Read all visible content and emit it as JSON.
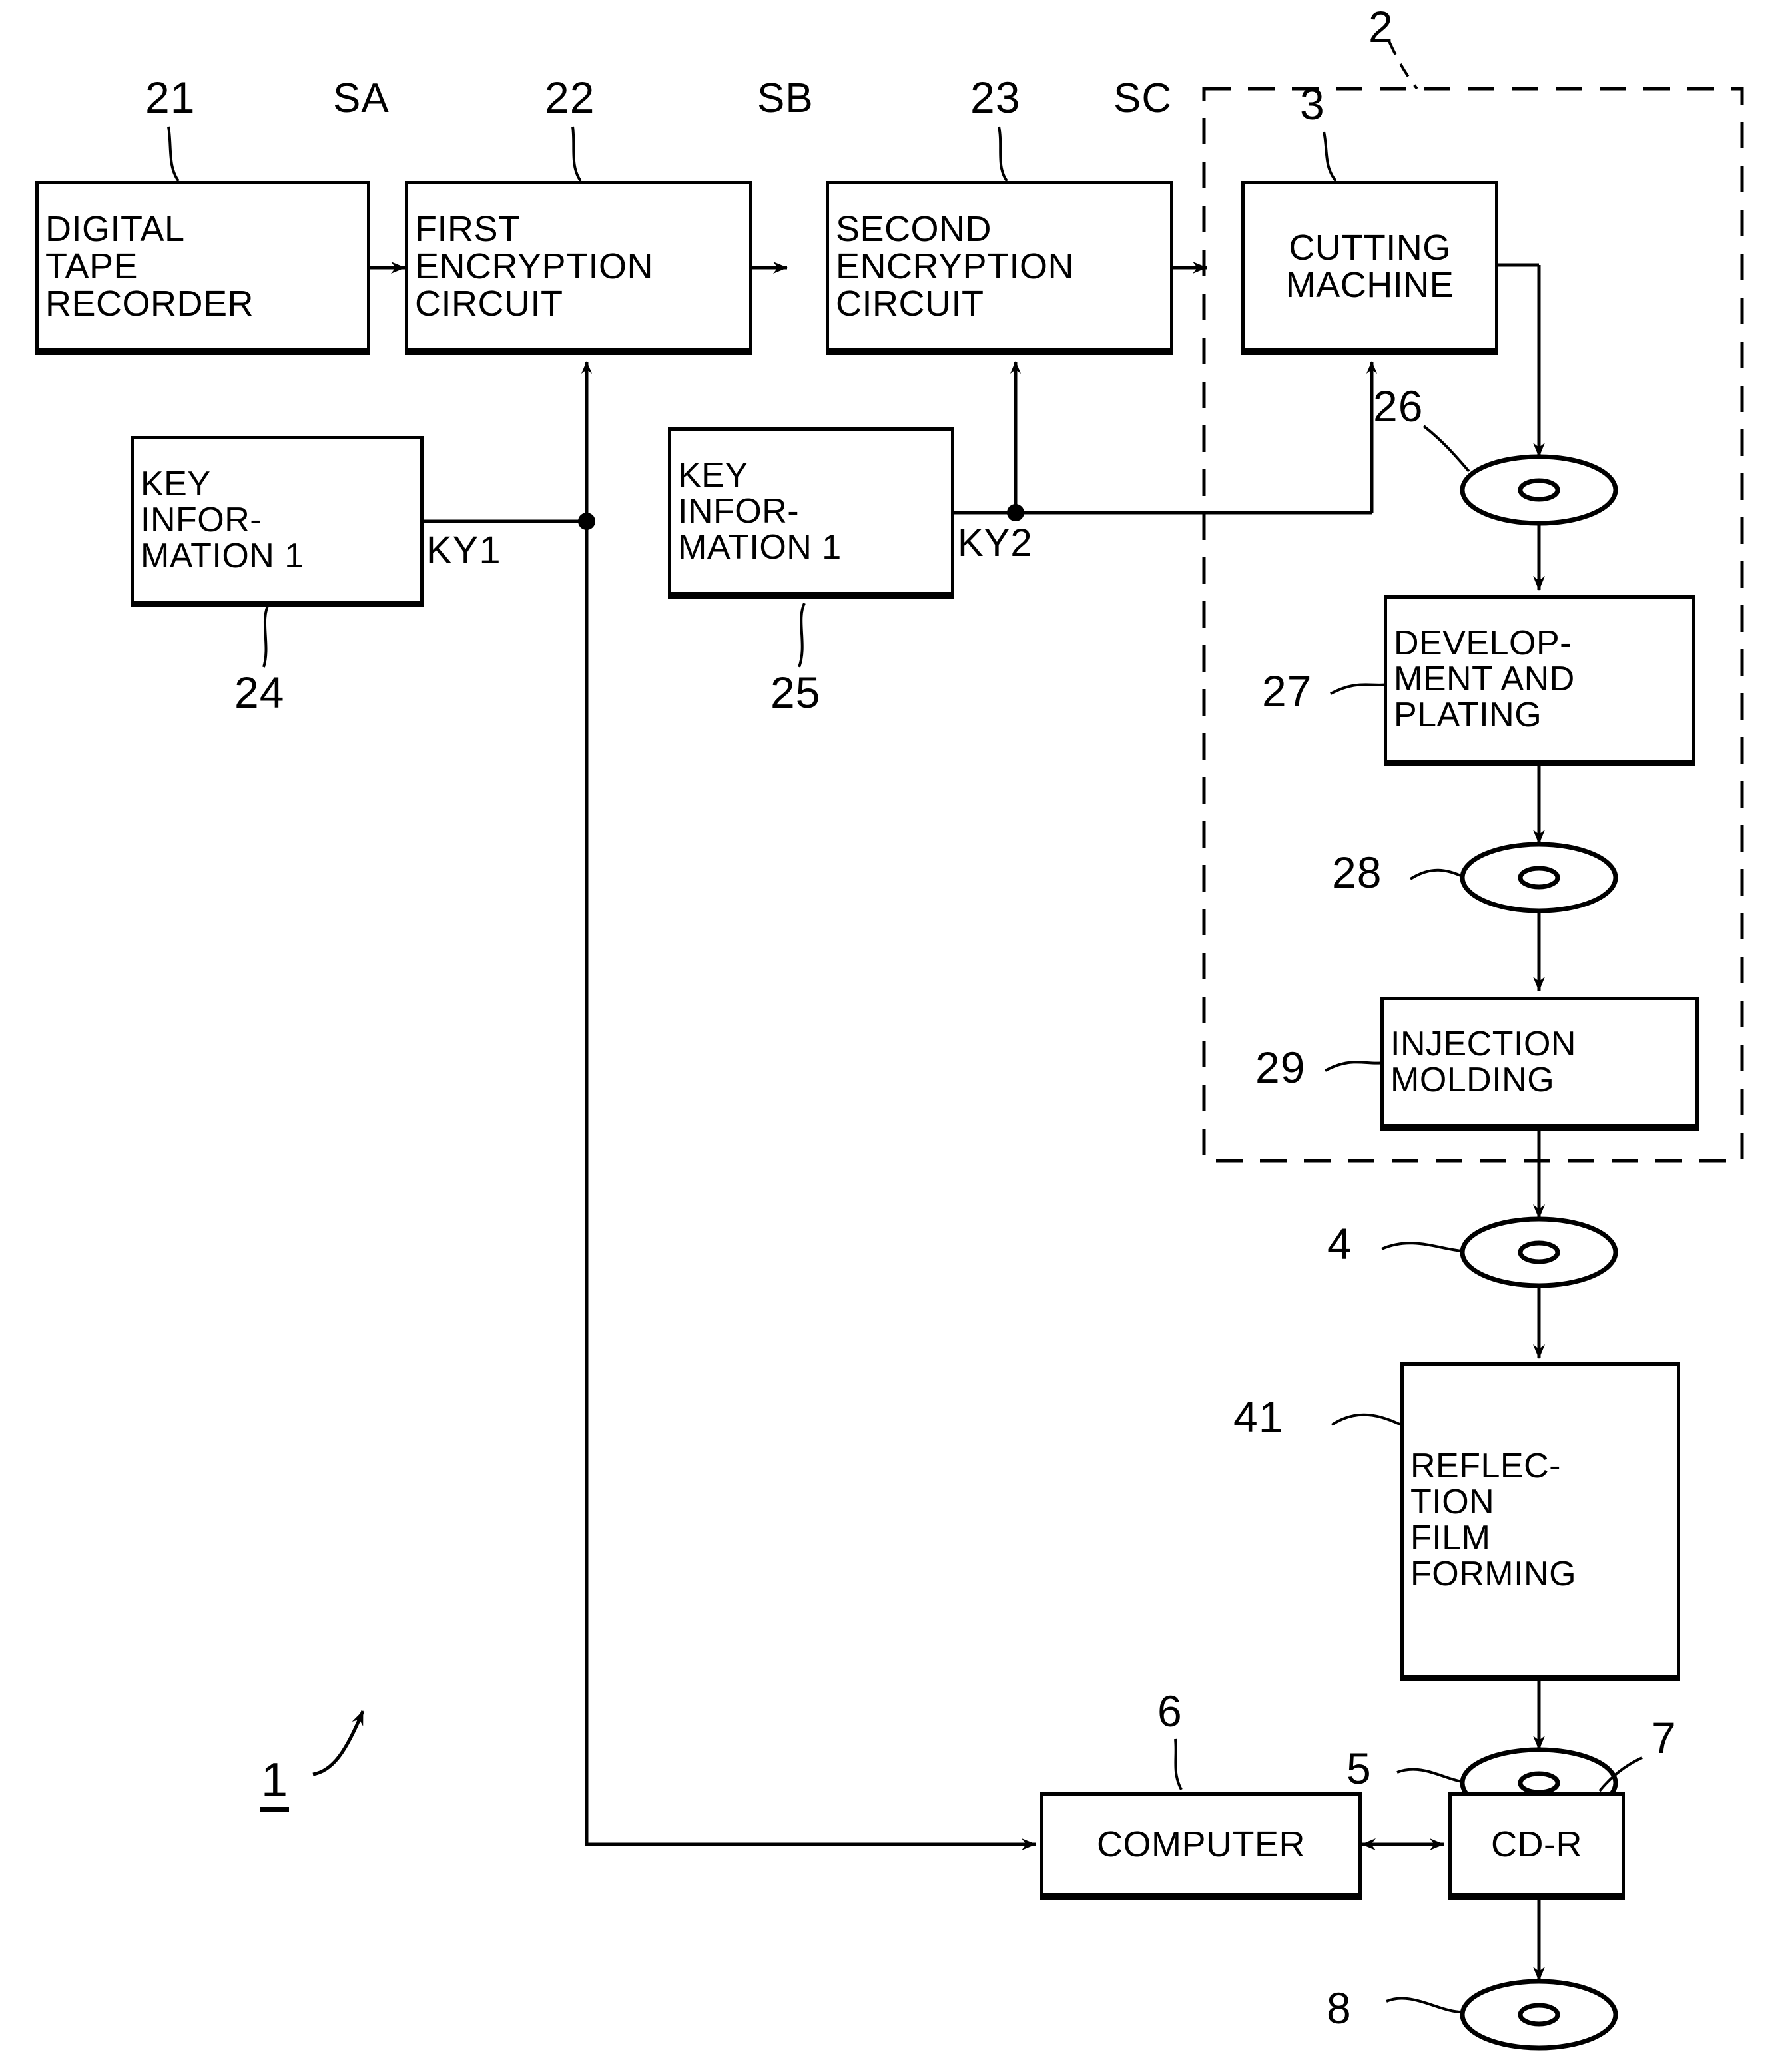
{
  "figure": {
    "figure_number": "1",
    "enclosure_label": "2"
  },
  "blocks": [
    {
      "id": "digital-tape-recorder",
      "ref": "21",
      "lines": [
        "DIGITAL",
        "TAPE",
        "RECORDER"
      ]
    },
    {
      "id": "first-encryption-circuit",
      "ref": "22",
      "lines": [
        "FIRST",
        "ENCRYPTION",
        "CIRCUIT"
      ]
    },
    {
      "id": "second-encryption-circuit",
      "ref": "23",
      "lines": [
        "SECOND",
        "ENCRYPTION",
        "CIRCUIT"
      ]
    },
    {
      "id": "cutting-machine",
      "ref": "3",
      "lines": [
        "CUTTING",
        "MACHINE"
      ]
    },
    {
      "id": "key-information-1",
      "ref": "24",
      "lines": [
        "KEY",
        "INFOR-",
        "MATION 1"
      ]
    },
    {
      "id": "key-information-2",
      "ref": "25",
      "lines": [
        "KEY",
        "INFOR-",
        "MATION 1"
      ]
    },
    {
      "id": "development-and-plating",
      "ref": "27",
      "lines": [
        "DEVELOP-",
        "MENT AND",
        "PLATING"
      ]
    },
    {
      "id": "injection-molding",
      "ref": "29",
      "lines": [
        "INJECTION",
        "MOLDING"
      ]
    },
    {
      "id": "reflection-film-forming",
      "ref": "41",
      "lines": [
        "REFLEC-",
        "TION",
        "FILM",
        "FORMING"
      ]
    },
    {
      "id": "computer",
      "ref": "6",
      "lines": [
        "COMPUTER"
      ]
    },
    {
      "id": "cd-r",
      "ref": "7",
      "lines": [
        "CD-R"
      ]
    }
  ],
  "signals": {
    "sa": "SA",
    "sb": "SB",
    "sc": "SC",
    "ky1": "KY1",
    "ky2": "KY2"
  },
  "refs": {
    "r21": "21",
    "r22": "22",
    "r23": "23",
    "r24": "24",
    "r25": "25",
    "r26": "26",
    "r27": "27",
    "r28": "28",
    "r29": "29",
    "r2": "2",
    "r3": "3",
    "r4": "4",
    "r41": "41",
    "r5": "5",
    "r6": "6",
    "r7": "7",
    "r8": "8"
  },
  "discs": [
    {
      "id": "disc-26",
      "ref": "26"
    },
    {
      "id": "disc-28",
      "ref": "28"
    },
    {
      "id": "disc-4",
      "ref": "4"
    },
    {
      "id": "disc-5",
      "ref": "5"
    },
    {
      "id": "disc-8",
      "ref": "8"
    }
  ],
  "text": {
    "dtr_l1": "DIGITAL",
    "dtr_l2": "TAPE",
    "dtr_l3": "RECORDER",
    "fec_l1": "FIRST",
    "fec_l2": "ENCRYPTION",
    "fec_l3": "CIRCUIT",
    "sec_l1": "SECOND",
    "sec_l2": "ENCRYPTION",
    "sec_l3": "CIRCUIT",
    "cm_l1": "CUTTING",
    "cm_l2": "MACHINE",
    "ki1_l1": "KEY",
    "ki1_l2": "INFOR-",
    "ki1_l3": "MATION 1",
    "ki2_l1": "KEY",
    "ki2_l2": "INFOR-",
    "ki2_l3": "MATION 1",
    "dev_l1": "DEVELOP-",
    "dev_l2": "MENT AND",
    "dev_l3": "PLATING",
    "inj_l1": "INJECTION",
    "inj_l2": "MOLDING",
    "rff_l1": "REFLEC-",
    "rff_l2": "TION",
    "rff_l3": "FILM",
    "rff_l4": "FORMING",
    "computer": "COMPUTER",
    "cdr": "CD-R",
    "fig_id": "1"
  },
  "colors": {
    "ink": "#000000",
    "paper": "#ffffff"
  }
}
